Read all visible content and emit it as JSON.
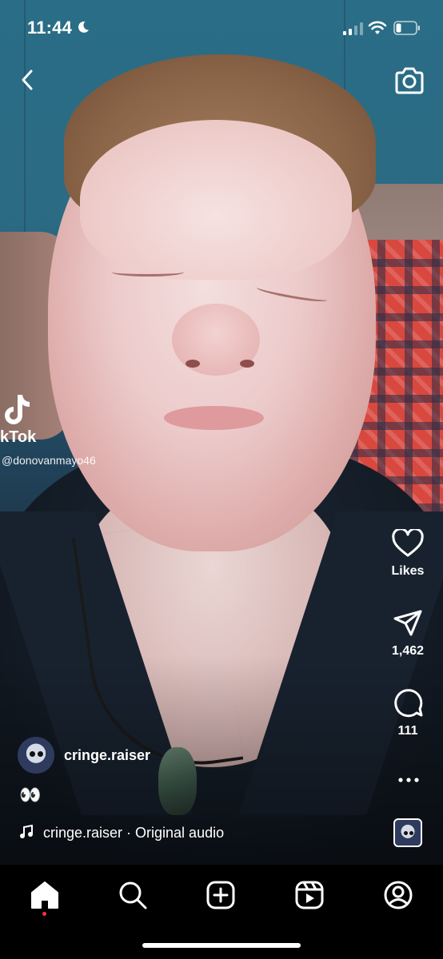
{
  "status_bar": {
    "time": "11:44",
    "icons": [
      "moon-icon",
      "cellular-signal-icon",
      "wifi-icon",
      "battery-icon"
    ]
  },
  "top_bar": {
    "icons": [
      "back-chevron-icon",
      "camera-icon"
    ]
  },
  "watermark": {
    "brand": "kTok",
    "handle": "donovanmayo46"
  },
  "actions": {
    "likes_label": "Likes",
    "shares_count": "1,462",
    "comments_count": "111"
  },
  "post": {
    "username": "cringe.raiser",
    "caption": "👀",
    "audio": "cringe.raiser · Original audio"
  },
  "tab_bar": {
    "items": [
      "home-icon",
      "search-icon",
      "create-icon",
      "reels-icon",
      "profile-icon"
    ],
    "active": "home"
  },
  "colors": {
    "background": "#000000",
    "text": "#ffffff",
    "notification_dot": "#ff3040"
  }
}
